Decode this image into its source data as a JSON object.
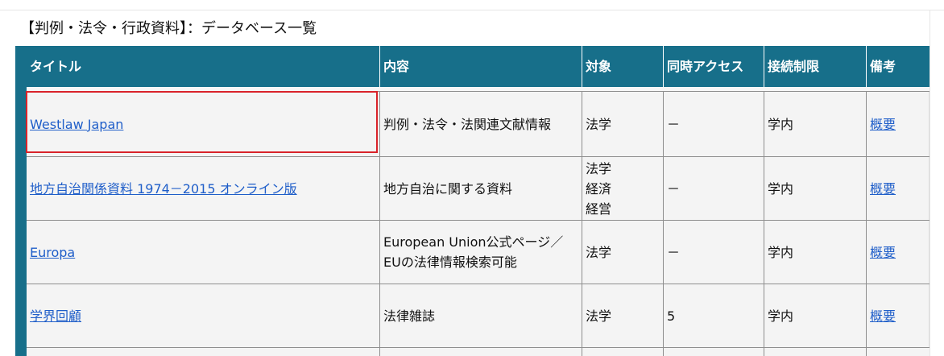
{
  "heading": "【判例・法令・行政資料】：データベース一覧",
  "table": {
    "headers": [
      "タイトル",
      "内容",
      "対象",
      "同時アクセス",
      "接続制限",
      "備考"
    ],
    "rows": [
      {
        "title": "Westlaw Japan",
        "content": [
          "判例・法令・法関連文献情報"
        ],
        "target": [
          "法学"
        ],
        "access": "－",
        "limit": "学内",
        "note": "概要"
      },
      {
        "title": "地方自治関係資料 1974－2015 オンライン版",
        "content": [
          "地方自治に関する資料"
        ],
        "target": [
          "法学",
          "経済",
          "経営"
        ],
        "access": "－",
        "limit": "学内",
        "note": "概要"
      },
      {
        "title": "Europa",
        "content": [
          "European Union公式ページ／",
          "EUの法律情報検索可能"
        ],
        "target": [
          "法学"
        ],
        "access": "－",
        "limit": "学内",
        "note": "概要"
      },
      {
        "title": "学界回顧",
        "content": [
          "法律雑誌"
        ],
        "target": [
          "法学"
        ],
        "access": "5",
        "limit": "学内",
        "note": "概要"
      }
    ]
  },
  "highlight": {
    "row_index": 0,
    "color": "#d9232a"
  },
  "colors": {
    "header_bg": "#176f8a",
    "link": "#1f5ec9",
    "cell_bg": "#f4f4f4"
  }
}
